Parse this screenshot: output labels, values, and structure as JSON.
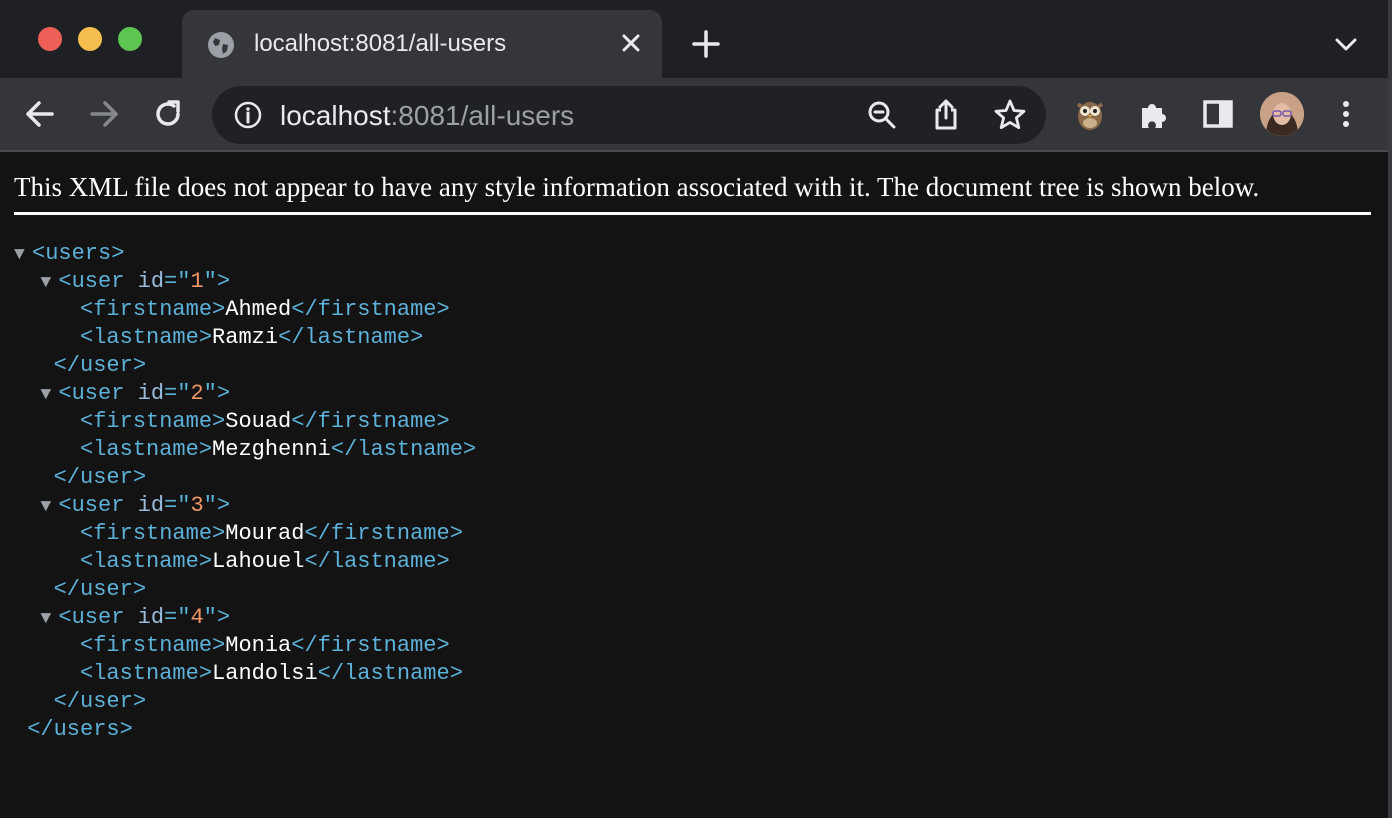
{
  "tab": {
    "title": "localhost:8081/all-users",
    "icon": "globe-icon"
  },
  "omnibox": {
    "host": "localhost",
    "rest": ":8081/all-users"
  },
  "toolbar_icons": [
    "back-arrow-icon",
    "forward-arrow-icon",
    "reload-icon",
    "zoom-icon",
    "share-icon",
    "star-icon",
    "owl-extension-icon",
    "puzzle-extension-icon",
    "side-panel-icon",
    "more-vert-icon"
  ],
  "notice": "This XML file does not appear to have any style information associated with it. The document tree is shown below.",
  "xml": {
    "root_tag": "users",
    "user_tag": "user",
    "attr_name": "id",
    "first_tag": "firstname",
    "last_tag": "lastname",
    "toggle": "▼",
    "users": [
      {
        "id": "1",
        "firstname": "Ahmed",
        "lastname": "Ramzi"
      },
      {
        "id": "2",
        "firstname": "Souad",
        "lastname": "Mezghenni"
      },
      {
        "id": "3",
        "firstname": "Mourad",
        "lastname": "Lahouel"
      },
      {
        "id": "4",
        "firstname": "Monia",
        "lastname": "Landolsi"
      }
    ]
  },
  "colors": {
    "tag": "#5db0d7",
    "attr_value": "#f29766",
    "text": "#ffffff",
    "background": "#131314"
  }
}
